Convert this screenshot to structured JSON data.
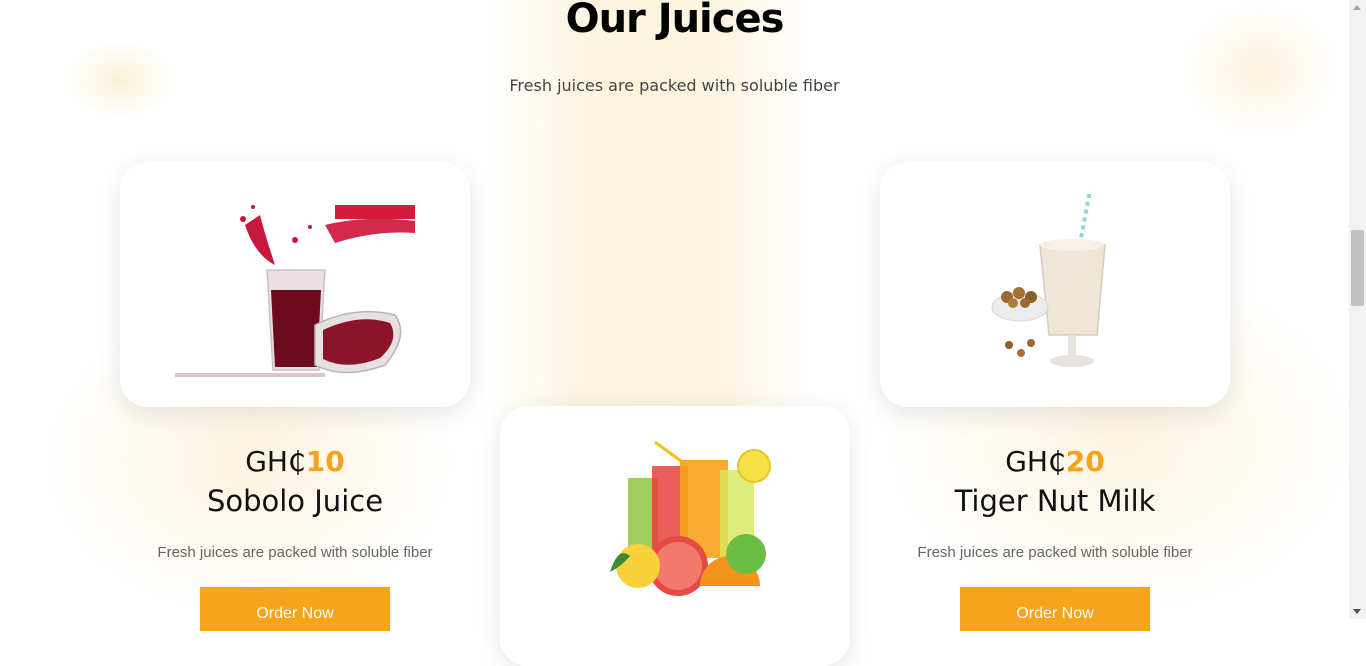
{
  "section": {
    "title": "Our Juices",
    "subtitle": "Fresh juices are packed with soluble fiber"
  },
  "products": [
    {
      "currency": "GH₵",
      "price": "10",
      "name": "Sobolo Juice",
      "description": "Fresh juices are packed with soluble fiber",
      "button": "Order Now",
      "image": "hibiscus-juice-image"
    },
    {
      "image": "mixed-fruit-juices-image"
    },
    {
      "currency": "GH₵",
      "price": "20",
      "name": "Tiger Nut Milk",
      "description": "Fresh juices are packed with soluble fiber",
      "button": "Order Now",
      "image": "tiger-nut-milk-image"
    }
  ],
  "colors": {
    "accent": "#f8a41b",
    "price_accent": "#f6a21c",
    "background_tint": "#fbf0d0"
  }
}
